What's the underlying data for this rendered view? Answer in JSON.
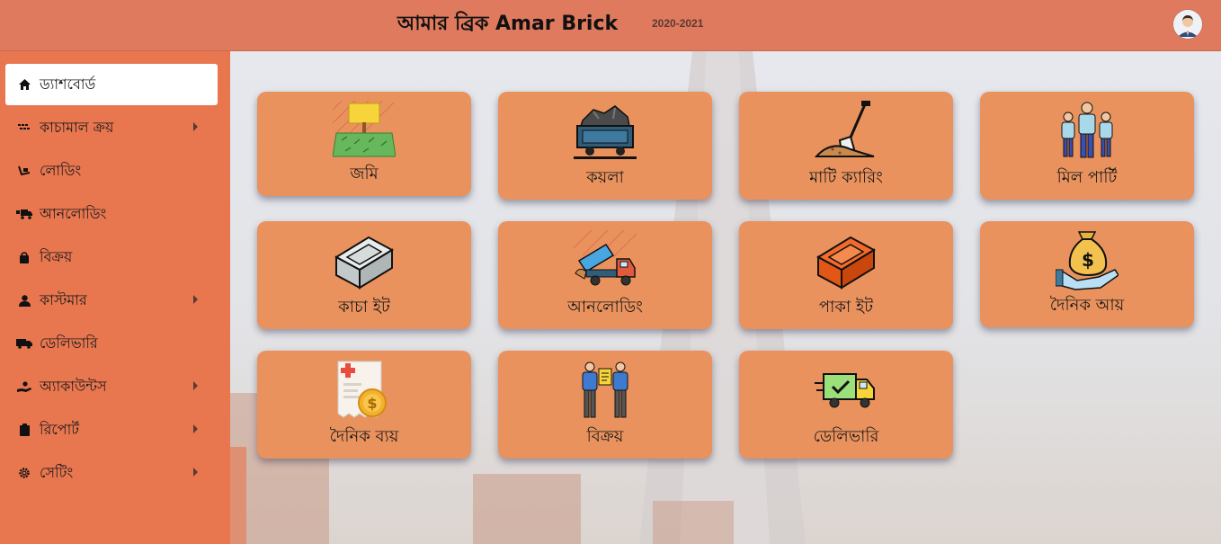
{
  "header": {
    "app_title": "আমার ব্রিক Amar Brick",
    "session": "2020-2021",
    "avatar_icon": "user-avatar-icon"
  },
  "sidebar": {
    "items": [
      {
        "label": "ড্যাশবোর্ড",
        "icon": "home-icon",
        "active": true,
        "submenu": false
      },
      {
        "label": "কাচামাল ক্রয়",
        "icon": "bricks-icon",
        "submenu": true
      },
      {
        "label": "লোডিং",
        "icon": "loading-icon",
        "submenu": false
      },
      {
        "label": "আনলোডিং",
        "icon": "truck-unload-icon",
        "submenu": false
      },
      {
        "label": "বিক্রয়",
        "icon": "shopping-bag-icon",
        "submenu": false
      },
      {
        "label": "কাস্টমার",
        "icon": "user-icon",
        "submenu": true
      },
      {
        "label": "ডেলিভারি",
        "icon": "delivery-truck-icon",
        "submenu": false
      },
      {
        "label": "অ্যাকাউন্টস",
        "icon": "hand-money-icon",
        "submenu": true
      },
      {
        "label": "রিপোর্ট",
        "icon": "clipboard-icon",
        "submenu": true
      },
      {
        "label": "সেটিং",
        "icon": "gear-icon",
        "submenu": true
      }
    ]
  },
  "tiles": [
    {
      "label": "জমি",
      "icon": "land-icon"
    },
    {
      "label": "কয়লা",
      "icon": "coal-cart-icon"
    },
    {
      "label": "মাটি ক্যারিং",
      "icon": "shovel-soil-icon"
    },
    {
      "label": "মিল পার্টি",
      "icon": "workers-group-icon"
    },
    {
      "label": "কাচা ইট",
      "icon": "raw-brick-icon"
    },
    {
      "label": "আনলোডিং",
      "icon": "dump-truck-icon"
    },
    {
      "label": "পাকা ইট",
      "icon": "burnt-brick-icon"
    },
    {
      "label": "দৈনিক আয়",
      "icon": "money-bag-icon"
    },
    {
      "label": "দৈনিক ব্যয়",
      "icon": "expense-bill-icon"
    },
    {
      "label": "বিক্রয়",
      "icon": "sale-handshake-icon"
    },
    {
      "label": "ডেলিভারি",
      "icon": "delivery-van-icon"
    }
  ],
  "colors": {
    "header": "#df7a5e",
    "sidebar": "#e8764f",
    "tile": "#ea925d",
    "active_item": "#ffffff"
  }
}
